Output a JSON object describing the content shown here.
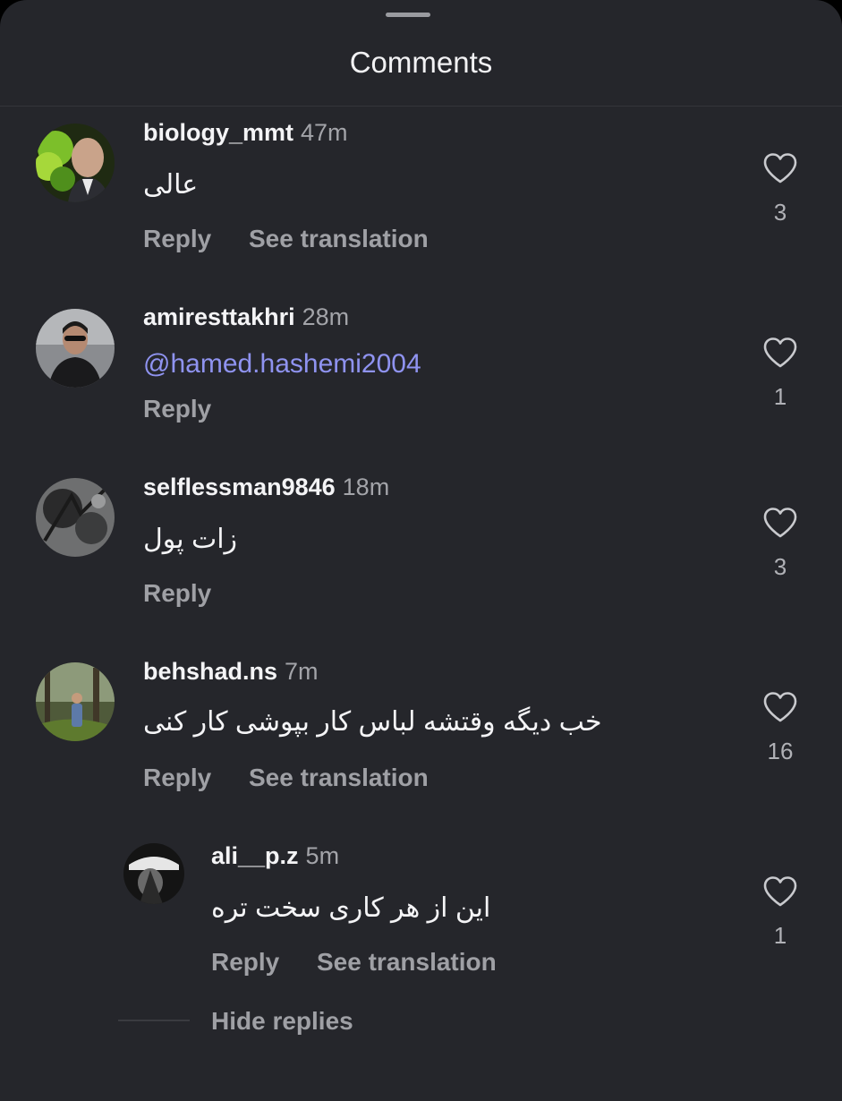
{
  "sheet": {
    "title": "Comments"
  },
  "comments": [
    {
      "username": "biology_mmt",
      "time": "47m",
      "text": "عالی",
      "likes": "3",
      "reply_label": "Reply",
      "translate_label": "See translation"
    },
    {
      "username": "amiresttakhri",
      "time": "28m",
      "text": "@hamed.hashemi2004",
      "likes": "1",
      "reply_label": "Reply"
    },
    {
      "username": "selflessman9846",
      "time": "18m",
      "text": "زات پول",
      "likes": "3",
      "reply_label": "Reply"
    },
    {
      "username": "behshad.ns",
      "time": "7m",
      "text": "خب دیگه وقتشه لباس کار بپوشی کار کنی",
      "likes": "16",
      "reply_label": "Reply",
      "translate_label": "See translation"
    }
  ],
  "reply": {
    "username": "ali__p.z",
    "time": "5m",
    "text": "این از هر کاری سخت تره",
    "likes": "1",
    "reply_label": "Reply",
    "translate_label": "See translation",
    "hide_replies_label": "Hide replies"
  },
  "icons": {
    "like": "heart-outline-icon"
  },
  "colors": {
    "background": "#25262b",
    "text": "#f4f4f6",
    "muted": "#a3a4a9",
    "mention": "#8f93f0"
  }
}
